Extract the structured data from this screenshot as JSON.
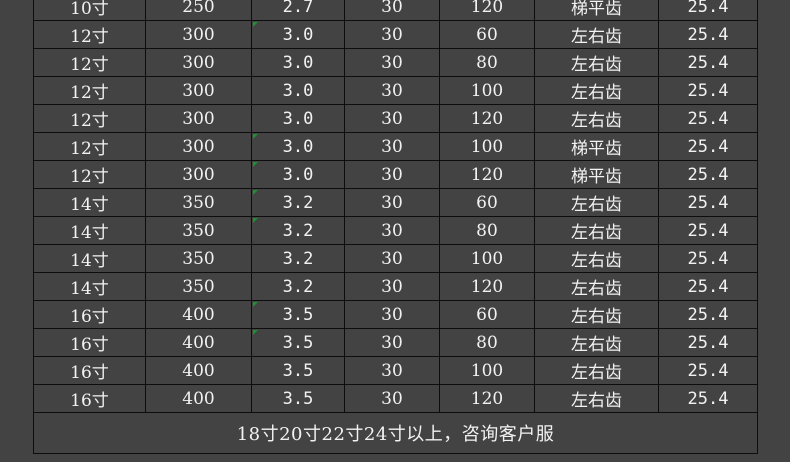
{
  "table": {
    "rows": [
      [
        "10寸",
        "250",
        "2.7",
        "30",
        "120",
        "梯平齿",
        "25.4"
      ],
      [
        "12寸",
        "300",
        "3.0",
        "30",
        "60",
        "左右齿",
        "25.4"
      ],
      [
        "12寸",
        "300",
        "3.0",
        "30",
        "80",
        "左右齿",
        "25.4"
      ],
      [
        "12寸",
        "300",
        "3.0",
        "30",
        "100",
        "左右齿",
        "25.4"
      ],
      [
        "12寸",
        "300",
        "3.0",
        "30",
        "120",
        "左右齿",
        "25.4"
      ],
      [
        "12寸",
        "300",
        "3.0",
        "30",
        "100",
        "梯平齿",
        "25.4"
      ],
      [
        "12寸",
        "300",
        "3.0",
        "30",
        "120",
        "梯平齿",
        "25.4"
      ],
      [
        "14寸",
        "350",
        "3.2",
        "30",
        "60",
        "左右齿",
        "25.4"
      ],
      [
        "14寸",
        "350",
        "3.2",
        "30",
        "80",
        "左右齿",
        "25.4"
      ],
      [
        "14寸",
        "350",
        "3.2",
        "30",
        "100",
        "左右齿",
        "25.4"
      ],
      [
        "14寸",
        "350",
        "3.2",
        "30",
        "120",
        "左右齿",
        "25.4"
      ],
      [
        "16寸",
        "400",
        "3.5",
        "30",
        "60",
        "左右齿",
        "25.4"
      ],
      [
        "16寸",
        "400",
        "3.5",
        "30",
        "80",
        "左右齿",
        "25.4"
      ],
      [
        "16寸",
        "400",
        "3.5",
        "30",
        "100",
        "左右齿",
        "25.4"
      ],
      [
        "16寸",
        "400",
        "3.5",
        "30",
        "120",
        "左右齿",
        "25.4"
      ]
    ],
    "flagged_rows": [
      1,
      5,
      6,
      7,
      8,
      11,
      12
    ],
    "flag_color": "#1f8f2f",
    "footer_note": "18寸20寸22寸24寸以上，咨询客户服"
  },
  "colors": {
    "background": "#434343",
    "grid_line": "#0d0d0d",
    "text": "#f2f2f2"
  }
}
